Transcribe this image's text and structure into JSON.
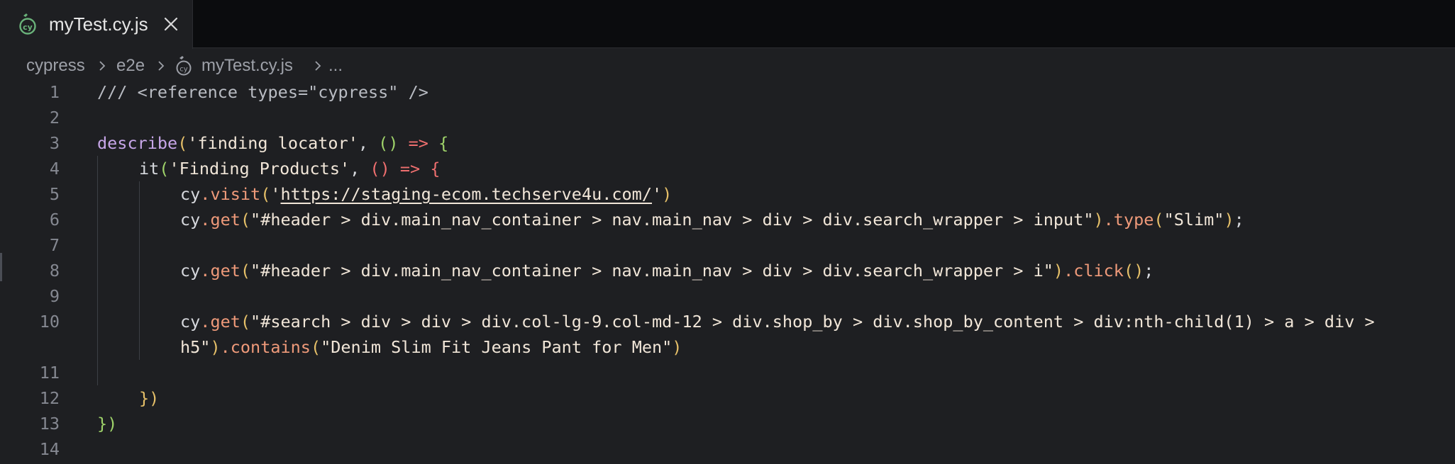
{
  "tab": {
    "label": "myTest.cy.js",
    "icon": "cypress-file-icon",
    "close_icon": "close-icon"
  },
  "breadcrumb": {
    "items": [
      "cypress",
      "e2e",
      "myTest.cy.js",
      "..."
    ]
  },
  "editor": {
    "line_numbers": [
      "1",
      "2",
      "3",
      "4",
      "5",
      "6",
      "7",
      "8",
      "9",
      "10",
      "11",
      "12",
      "13",
      "14"
    ],
    "line1": "/// <reference types=\"cypress\" />",
    "line3": {
      "describe": "describe",
      "open": "(",
      "title": "'finding locator'",
      "comma": ", ",
      "params": "()",
      "arrow": " => ",
      "brace": "{"
    },
    "line4": {
      "it": "it",
      "open": "(",
      "title": "'Finding Products'",
      "comma": ", ",
      "params": "()",
      "arrow": " => ",
      "brace": "{"
    },
    "line5": {
      "cy": "cy",
      "method": ".visit",
      "open": "(",
      "q1": "'",
      "url": "https://staging-ecom.techserve4u.com/",
      "q2": "'",
      "close": ")"
    },
    "line6": {
      "cy": "cy",
      "method": ".get",
      "open": "(",
      "selector": "\"#header > div.main_nav_container > nav.main_nav > div > div.search_wrapper > input\"",
      "close": ")",
      "method2": ".type",
      "open2": "(",
      "arg": "\"Slim\"",
      "close2": ")",
      "semi": ";"
    },
    "line8": {
      "cy": "cy",
      "method": ".get",
      "open": "(",
      "selector": "\"#header > div.main_nav_container > nav.main_nav > div > div.search_wrapper > i\"",
      "close": ")",
      "method2": ".click",
      "parens": "()",
      "semi": ";"
    },
    "line10": {
      "cy": "cy",
      "method": ".get",
      "open": "(",
      "selector_a": "\"#search > div > div > div.col-lg-9.col-md-12 > div.shop_by > div.shop_by_content > div:nth-child(1) > a > div >",
      "selector_b": "h5\"",
      "close": ")",
      "method2": ".contains",
      "open2": "(",
      "arg": "\"Denim Slim Fit Jeans Pant for Men\"",
      "close2": ")"
    },
    "line12": "})",
    "line13": "})"
  }
}
